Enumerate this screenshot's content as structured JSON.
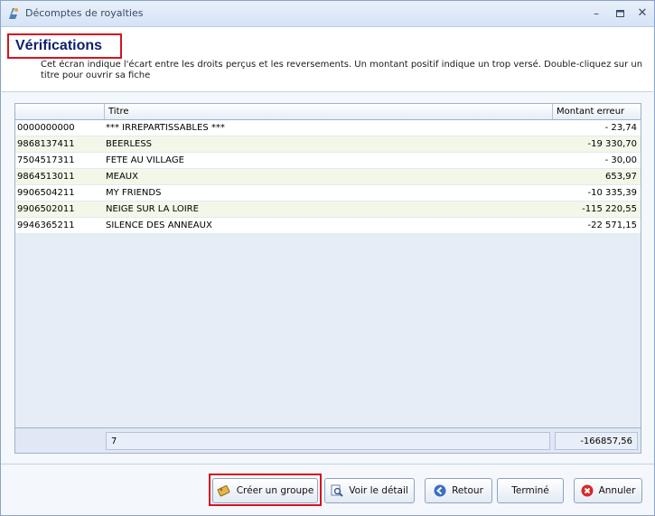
{
  "window": {
    "title": "Décomptes de royalties"
  },
  "header": {
    "title": "Vérifications",
    "description": "Cet écran indique l'écart entre les droits perçus et les reversements. Un montant positif indique un trop versé. Double-cliquez sur un titre pour ouvrir sa fiche"
  },
  "table": {
    "columns": [
      "",
      "Titre",
      "Montant erreur"
    ],
    "rows": [
      {
        "code": "0000000000",
        "titre": "*** IRREPARTISSABLES ***",
        "montant": "- 23,74"
      },
      {
        "code": "9868137411",
        "titre": "BEERLESS",
        "montant": "-19 330,70"
      },
      {
        "code": "7504517311",
        "titre": "FETE AU VILLAGE",
        "montant": "- 30,00"
      },
      {
        "code": "9864513011",
        "titre": "MEAUX",
        "montant": "653,97"
      },
      {
        "code": "9906504211",
        "titre": "MY FRIENDS",
        "montant": "-10 335,39"
      },
      {
        "code": "9906502011",
        "titre": "NEIGE SUR LA LOIRE",
        "montant": "-115 220,55"
      },
      {
        "code": "9946365211",
        "titre": "SILENCE DES ANNEAUX",
        "montant": "-22 571,15"
      }
    ],
    "footer": {
      "count": "7",
      "total": "-166857,56"
    }
  },
  "buttons": {
    "create_group": "Créer un groupe",
    "view_detail": "Voir le détail",
    "back": "Retour",
    "done": "Terminé",
    "cancel": "Annuler"
  }
}
